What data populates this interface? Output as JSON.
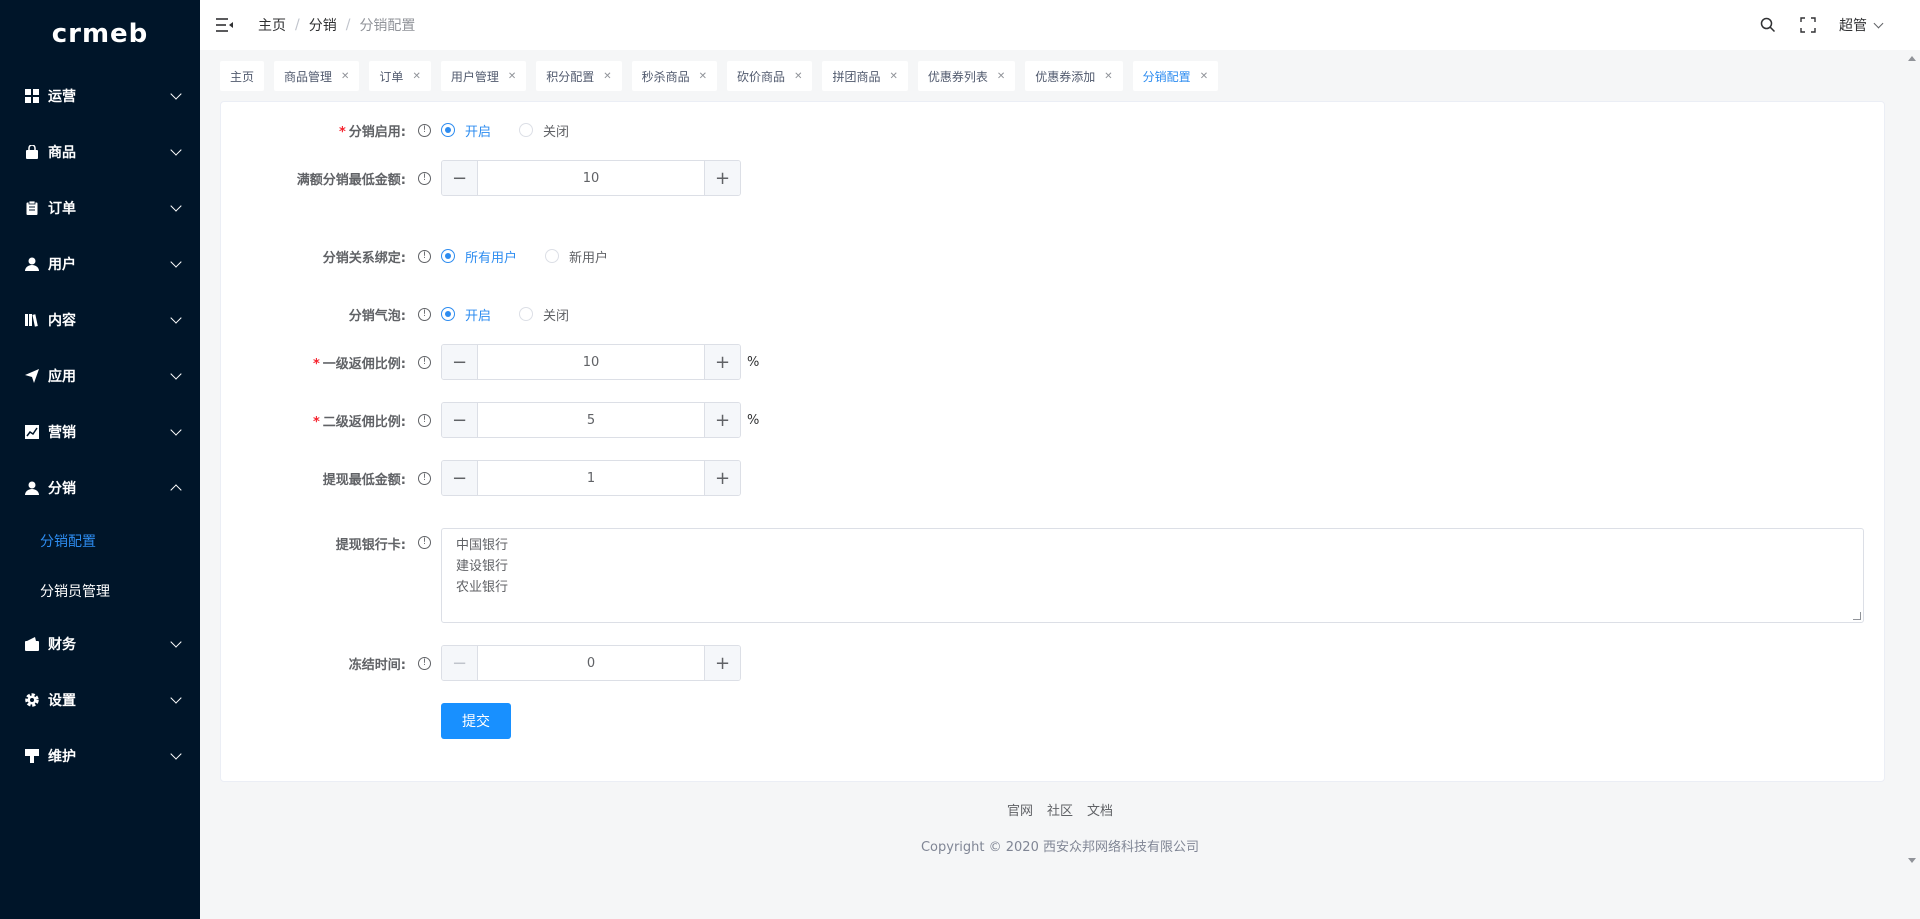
{
  "brand": {
    "logo_text": "crmeb"
  },
  "sidebar": {
    "items": [
      {
        "label": "运营",
        "icon": "grid-icon"
      },
      {
        "label": "商品",
        "icon": "bag-icon"
      },
      {
        "label": "订单",
        "icon": "clipboard-icon"
      },
      {
        "label": "用户",
        "icon": "user-icon"
      },
      {
        "label": "内容",
        "icon": "book-icon"
      },
      {
        "label": "应用",
        "icon": "send-icon"
      },
      {
        "label": "营销",
        "icon": "chart-icon"
      },
      {
        "label": "分销",
        "icon": "user-icon",
        "expanded": true
      },
      {
        "label": "财务",
        "icon": "wallet-icon"
      },
      {
        "label": "设置",
        "icon": "gear-icon"
      },
      {
        "label": "维护",
        "icon": "tool-icon"
      }
    ],
    "submenu": [
      {
        "label": "分销配置",
        "active": true
      },
      {
        "label": "分销员管理",
        "active": false
      }
    ]
  },
  "header": {
    "breadcrumb": [
      "主页",
      "分销",
      "分销配置"
    ],
    "user": "超管"
  },
  "tabs": [
    {
      "label": "主页",
      "closable": false
    },
    {
      "label": "商品管理",
      "closable": true
    },
    {
      "label": "订单",
      "closable": true
    },
    {
      "label": "用户管理",
      "closable": true
    },
    {
      "label": "积分配置",
      "closable": true
    },
    {
      "label": "秒杀商品",
      "closable": true
    },
    {
      "label": "砍价商品",
      "closable": true
    },
    {
      "label": "拼团商品",
      "closable": true
    },
    {
      "label": "优惠券列表",
      "closable": true
    },
    {
      "label": "优惠券添加",
      "closable": true
    },
    {
      "label": "分销配置",
      "closable": true,
      "active": true
    }
  ],
  "form": {
    "enable": {
      "label": "分销启用:",
      "required": true,
      "options": [
        "开启",
        "关闭"
      ],
      "selected": "开启"
    },
    "min_amount": {
      "label": "满额分销最低金额:",
      "value": "10"
    },
    "binding": {
      "label": "分销关系绑定:",
      "options": [
        "所有用户",
        "新用户"
      ],
      "selected": "所有用户"
    },
    "bubble": {
      "label": "分销气泡:",
      "options": [
        "开启",
        "关闭"
      ],
      "selected": "开启"
    },
    "level1": {
      "label": "一级返佣比例:",
      "required": true,
      "value": "10",
      "unit": "%"
    },
    "level2": {
      "label": "二级返佣比例:",
      "required": true,
      "value": "5",
      "unit": "%"
    },
    "withdraw_min": {
      "label": "提现最低金额:",
      "value": "1"
    },
    "bank_cards": {
      "label": "提现银行卡:",
      "lines": [
        "中国银行",
        "建设银行",
        "农业银行"
      ]
    },
    "freeze": {
      "label": "冻结时间:",
      "value": "0"
    },
    "submit_label": "提交"
  },
  "footer": {
    "links": [
      "官网",
      "社区",
      "文档"
    ],
    "copyright": "Copyright © 2020 西安众邦网络科技有限公司"
  },
  "colors": {
    "sidebar_bg": "#001529",
    "accent": "#2d8cf0",
    "primary_btn": "#1890ff",
    "required": "#f5222d"
  }
}
